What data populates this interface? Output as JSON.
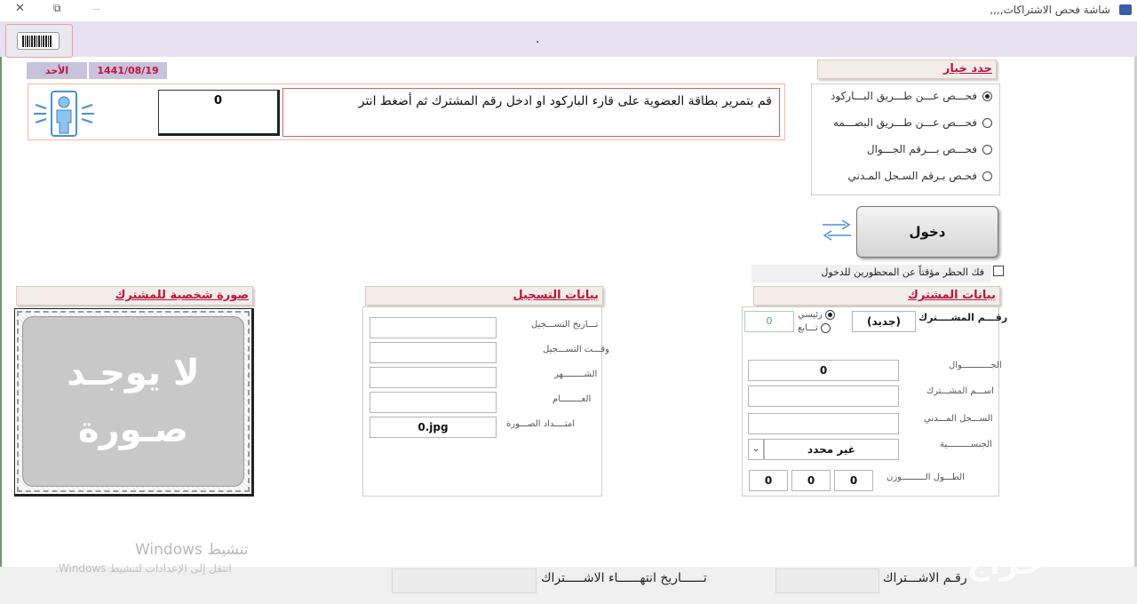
{
  "window": {
    "title": "شاشة فحص الاشتراكات,,,,",
    "close": "✕",
    "restore": "⧉",
    "minimize": "—"
  },
  "header": {
    "marker": "."
  },
  "date_bar": {
    "date": "1441/08/19",
    "day": "الأحد"
  },
  "prompt": {
    "id_value": "0",
    "text": "قم بتمرير بطاقة العضوية على قارء الباركود او ادخل رقم المشترك ثم أضغط انتر"
  },
  "options": {
    "title": "حدد خيار",
    "items": [
      {
        "label": "فحـــص عـــن طـــريق البـــاركود",
        "selected": true
      },
      {
        "label": "فحـــص عـــن طـــريق البصـــمه",
        "selected": false
      },
      {
        "label": "فحـــص بـــرقم الجـــوال",
        "selected": false
      },
      {
        "label": "فحـص بـرقم السـجل المـدني",
        "selected": false
      }
    ]
  },
  "enter_button": "دخول",
  "unblock": {
    "label": "فك الحظر مؤقتاً عن المحظورين للدخول",
    "checked": false
  },
  "subscriber": {
    "title": "بيانات المشترك",
    "id_label": "رقـــم المشــــترك",
    "id_status": "(جديد)",
    "type_main": "رئيسي",
    "type_sub": "تـــابع",
    "counter": "0",
    "mobile_label": "الجـــــــــــوال",
    "mobile": "0",
    "name_label": "اســـم المشـــترك",
    "name": "",
    "civil_label": "الســـجل المـــدني",
    "civil": "",
    "nationality_label": "الجنســـــــــية",
    "nationality": "غير محدد",
    "height_weight_label": "الطـــول الـــــــــوزن",
    "hw": [
      "0",
      "0",
      "0"
    ]
  },
  "registration": {
    "title": "بيانات التسجيل",
    "date_label": "تـــاريخ التســـجيل",
    "time_label": "وقـــت التســـجيل",
    "month_label": "الشــــــــهر",
    "year_label": "العــــــــام",
    "ext_label": "امتــــداد الصـــورة",
    "ext_value": "0.jpg"
  },
  "photo": {
    "title": "صورة شخصية للمشترك",
    "line1": "لا يوجـد",
    "line2": "صـورة"
  },
  "footer": {
    "sub_no_label": "رقـم الاشـــتراك",
    "end_date_label": "تــــــاريخ انتهــــــاء الاشـــــتراك"
  },
  "watermark": {
    "title": "تنشيط Windows",
    "subtitle": "انتقل إلى الإعدادات لتنشيط Windows."
  }
}
